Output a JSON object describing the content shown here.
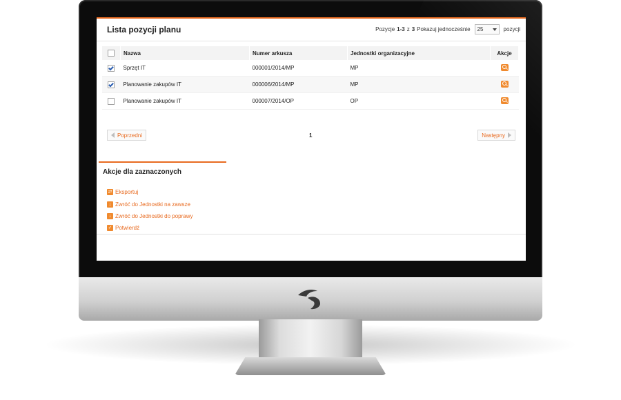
{
  "list": {
    "title": "Lista pozycji planu",
    "pager": {
      "prefix": "Pozycje",
      "range": "1-3",
      "of": "z",
      "total": "3",
      "show_label": "Pokazuj jednocześnie",
      "page_size": "25",
      "suffix": "pozycji"
    },
    "columns": [
      "Nazwa",
      "Numer arkusza",
      "Jednostki organizacyjne",
      "Akcje"
    ],
    "rows": [
      {
        "checked": true,
        "name": "Sprzęt IT",
        "sheet": "000001/2014/MP",
        "unit": "MP"
      },
      {
        "checked": true,
        "name": "Planowanie zakupów IT",
        "sheet": "000006/2014/MP",
        "unit": "MP"
      },
      {
        "checked": false,
        "name": "Planowanie zakupów IT",
        "sheet": "000007/2014/OP",
        "unit": "OP"
      }
    ],
    "prev_label": "Poprzedni",
    "next_label": "Następny",
    "page": "1"
  },
  "actions": {
    "title": "Akcje dla zaznaczonych",
    "items": [
      {
        "label": "Eksportuj",
        "icon": "export-icon"
      },
      {
        "label": "Zwróć do Jednostki na zawsze",
        "icon": "return-down-icon"
      },
      {
        "label": "Zwróć do Jednostki do poprawy",
        "icon": "return-down-icon"
      },
      {
        "label": "Potwierdź",
        "icon": "check-icon"
      }
    ]
  },
  "colors": {
    "accent": "#e86a1f",
    "icon": "#f08a2e",
    "bezel": "#0c0c0c"
  }
}
